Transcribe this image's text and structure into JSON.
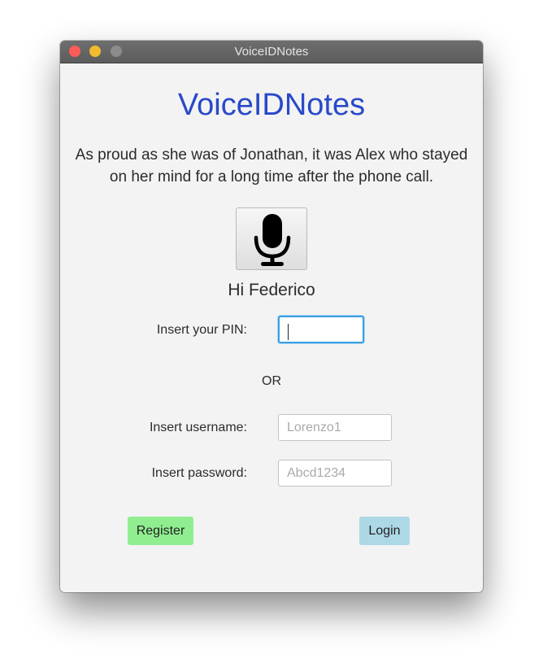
{
  "window": {
    "title": "VoiceIDNotes"
  },
  "app": {
    "title": "VoiceIDNotes",
    "sentence": "As proud as she was of Jonathan, it was Alex who stayed on her mind for a long time after the phone call.",
    "greeting": "Hi Federico",
    "mic_icon": "microphone-icon"
  },
  "pin": {
    "label": "Insert your PIN:",
    "value": ""
  },
  "separator": "OR",
  "username": {
    "label": "Insert username:",
    "placeholder": "Lorenzo1"
  },
  "password": {
    "label": "Insert password:",
    "placeholder": "Abcd1234"
  },
  "buttons": {
    "register": "Register",
    "login": "Login"
  },
  "colors": {
    "title": "#2949c9",
    "register_bg": "#90ee90",
    "login_bg": "#add8e6",
    "focus_border": "#3a9fe3"
  }
}
